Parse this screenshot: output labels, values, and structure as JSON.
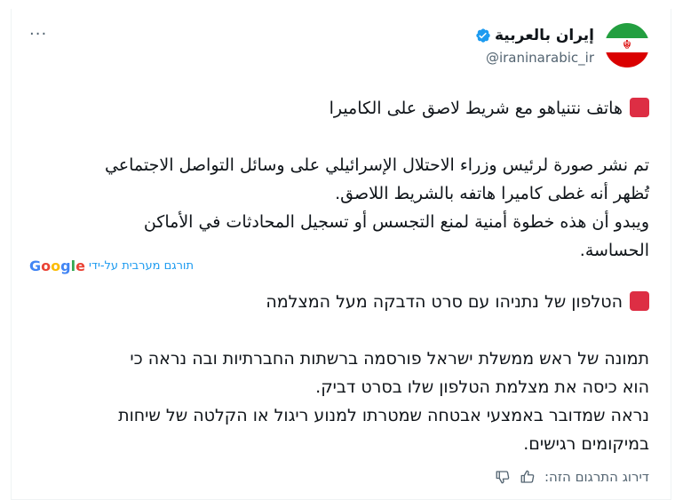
{
  "account": {
    "name": "إيران بالعربية",
    "handle": "@iraninarabic_ir"
  },
  "more_label": "···",
  "tweet_ar": {
    "line1": "هاتف نتنياهو مع شريط لاصق على الكاميرا",
    "line2": "تم نشر صورة لرئيس وزراء الاحتلال الإسرائيلي على وسائل التواصل الاجتماعي",
    "line3": "تُظهر أنه غطى كاميرا هاتفه بالشريط اللاصق.",
    "line4": "ويبدو أن هذه خطوة أمنية لمنع التجسس أو تسجيل المحادثات في الأماكن",
    "line5": "الحساسة."
  },
  "translation": {
    "by_label": "תורגם מערבית על-ידי",
    "provider": "Google"
  },
  "tweet_he": {
    "line1": "הטלפון של נתניהו עם סרט הדבקה מעל המצלמה",
    "line2": "תמונה של ראש ממשלת ישראל פורסמה ברשתות החברתיות ובה נראה כי",
    "line3": "הוא כיסה את מצלמת הטלפון שלו בסרט דביק.",
    "line4": "נראה שמדובר באמצעי אבטחה שמטרתו למנוע ריגול או הקלטה של שיחות",
    "line5": "במיקומים רגישים."
  },
  "rating": {
    "label": "דירוג התרגום הזה:"
  },
  "colors": {
    "verified": "#1d9bf0",
    "link": "#1d9bf0",
    "muted": "#536471",
    "emoji_square": "#dd2e44"
  },
  "icons": {
    "verified": "verified-badge-icon",
    "more": "more-icon",
    "thumb_up": "thumb-up-icon",
    "thumb_down": "thumb-down-icon",
    "red_square": "red-square-emoji"
  }
}
